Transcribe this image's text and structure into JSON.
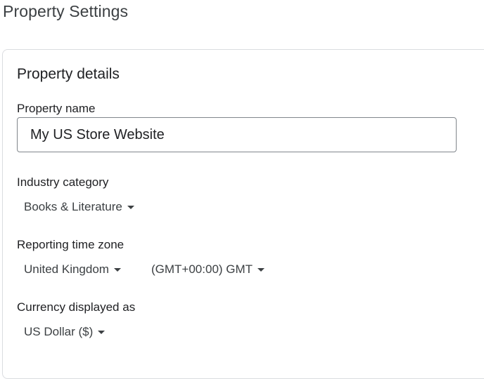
{
  "page": {
    "title": "Property Settings"
  },
  "card": {
    "title": "Property details"
  },
  "property_name": {
    "label": "Property name",
    "value": "My US Store Website"
  },
  "industry": {
    "label": "Industry category",
    "selected": "Books & Literature"
  },
  "timezone": {
    "label": "Reporting time zone",
    "country": "United Kingdom",
    "zone": "(GMT+00:00) GMT"
  },
  "currency": {
    "label": "Currency displayed as",
    "selected": "US Dollar ($)"
  },
  "icons": {
    "dropdown": "caret-down-icon"
  },
  "colors": {
    "text": "#3c4043",
    "border": "#dadce0",
    "input_border": "#80868b"
  }
}
